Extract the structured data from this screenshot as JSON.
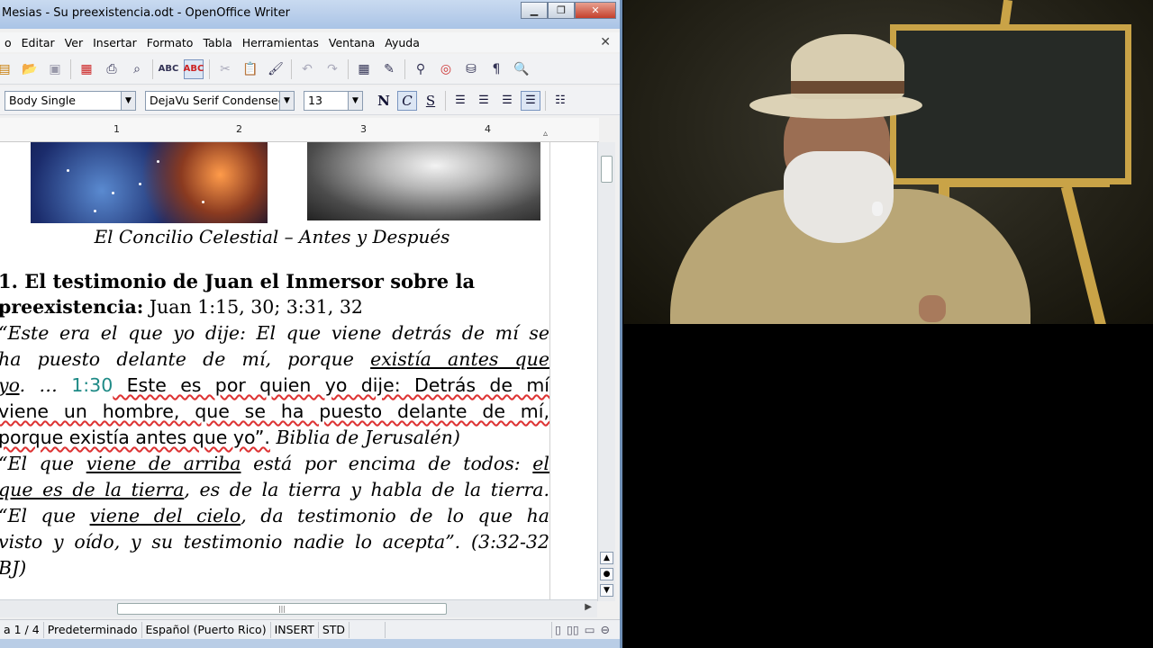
{
  "window": {
    "title": "Mesias - Su preexistencia.odt - OpenOffice Writer",
    "min": "▁",
    "max": "❐",
    "close": "✕"
  },
  "menu": {
    "items": [
      "o",
      "Editar",
      "Ver",
      "Insertar",
      "Formato",
      "Tabla",
      "Herramientas",
      "Ventana",
      "Ayuda"
    ],
    "doc_close": "✕"
  },
  "formatting": {
    "paragraph_style": "Body Single",
    "font_name": "DejaVu Serif Condensed",
    "font_size": "13",
    "bold": "N",
    "italic": "C",
    "underline": "S"
  },
  "ruler": {
    "ticks": [
      "1",
      "2",
      "3",
      "4"
    ]
  },
  "document": {
    "caption": "El Concilio Celestial – Antes y Después",
    "heading_line1": "1. El testimonio de Juan el Inmersor sobre la",
    "heading_line2_bold": "preexistencia:",
    "heading_line2_ref": " Juan 1:15, 30; 3:31, 32",
    "p1": {
      "l1": "“Este era el que yo dije: El que viene detrás de mí se",
      "l2_a": "ha puesto delante de mí, porque ",
      "l2_u": "existía antes que",
      "l3_u": "yo",
      "l3_b": ". … ",
      "l3_ref": "1:30",
      "l3_c": " Este es por quien yo dije: Detrás de mí",
      "l4": "viene un hombre, que se ha puesto delante de mí,",
      "l5_a": "porque existía antes que yo”.",
      "l5_b": " Biblia de Jerusalén)"
    },
    "p2": {
      "l1_a": "“El que ",
      "l1_u1": "viene de arriba",
      "l1_b": " está por encima de todos: ",
      "l1_u2": "el",
      "l2_u": "que es de la tierra",
      "l2_b": ", es de la tierra y habla de la tierra.",
      "l3_a": "“El que ",
      "l3_u": "viene del cielo",
      "l3_b": ", da testimonio de lo que ha",
      "l4": "visto y oído, y su testimonio nadie lo acepta”. (3:32-32",
      "l5": "BJ)"
    }
  },
  "statusbar": {
    "page": "a 1 / 4",
    "style": "Predeterminado",
    "language": "Español (Puerto Rico)",
    "mode": "INSERT",
    "selection": "STD"
  },
  "icons": [
    "new-icon",
    "open-icon",
    "save-icon",
    "pdf-icon",
    "print-icon",
    "preview-icon",
    "spellcheck-icon",
    "autospell-icon",
    "cut-icon",
    "paste-icon",
    "format-paintbrush-icon",
    "undo-icon",
    "redo-icon",
    "table-icon",
    "draw-icon",
    "find-icon",
    "navigator-icon",
    "datasource-icon",
    "nonprinting-icon",
    "zoom-icon"
  ]
}
